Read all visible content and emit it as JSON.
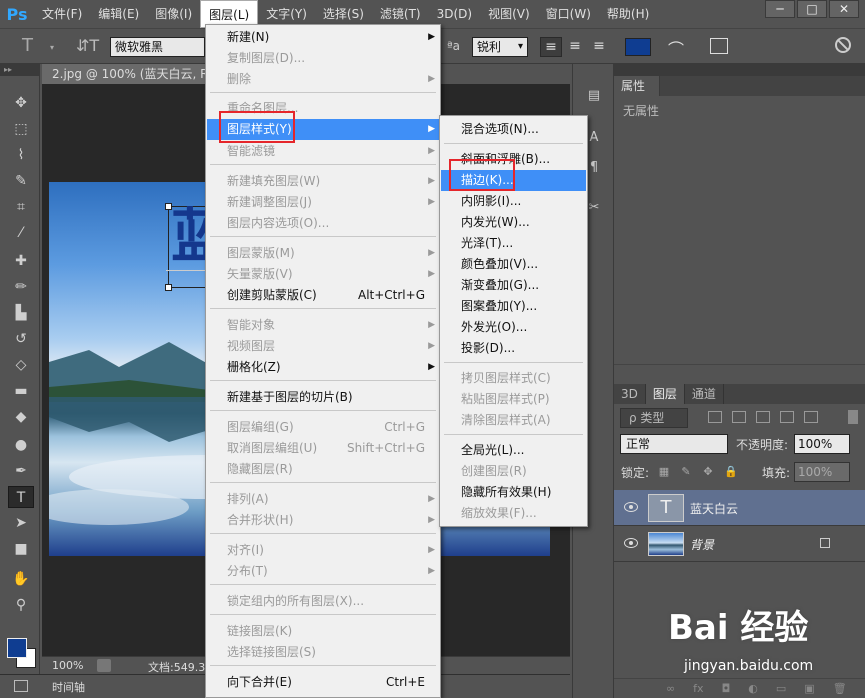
{
  "app": {
    "logo": "Ps"
  },
  "menubar": {
    "items": [
      "文件(F)",
      "编辑(E)",
      "图像(I)",
      "图层(L)",
      "文字(Y)",
      "选择(S)",
      "滤镜(T)",
      "3D(D)",
      "视图(V)",
      "窗口(W)",
      "帮助(H)"
    ],
    "active_index": 3
  },
  "window_buttons": [
    "─",
    "□",
    "✕"
  ],
  "options_bar": {
    "font_family": "微软雅黑",
    "aa_label": "ªa",
    "antialias": "锐利",
    "text_color": "#0f3d91"
  },
  "document": {
    "tab_title": "2.jpg @ 100% (蓝天白云, RG",
    "text_layer_char": "蓝",
    "zoom": "100%",
    "doc_info": "文档:549.3"
  },
  "timeline": {
    "label": "时间轴"
  },
  "properties_panel": {
    "tab": "属性",
    "empty_text": "无属性"
  },
  "layers_panel": {
    "tabs": [
      "3D",
      "图层",
      "通道"
    ],
    "active_tab": 1,
    "filter_label": "ρ 类型",
    "blend_mode": "正常",
    "opacity_label": "不透明度:",
    "opacity": "100%",
    "lock_label": "锁定:",
    "fill_label": "填充:",
    "fill": "100%",
    "layers": [
      {
        "name": "蓝天白云",
        "type": "text",
        "selected": true,
        "thumb": "T"
      },
      {
        "name": "背景",
        "type": "image",
        "selected": false,
        "locked": true
      }
    ],
    "footer_icons": [
      "∞",
      "fx",
      "◘",
      "◐",
      "▭",
      "▣",
      "🗑"
    ]
  },
  "layer_menu": {
    "items": [
      {
        "label": "新建(N)",
        "submenu": true,
        "disabled": false
      },
      {
        "label": "复制图层(D)...",
        "disabled": true
      },
      {
        "label": "删除",
        "submenu": true,
        "disabled": true
      },
      {
        "label": "重命名图层...",
        "disabled": true
      },
      {
        "label": "图层样式(Y)",
        "submenu": true,
        "highlight": true
      },
      {
        "label": "智能滤镜",
        "submenu": true,
        "disabled": true
      },
      {
        "label": "新建填充图层(W)",
        "submenu": true,
        "disabled": true
      },
      {
        "label": "新建调整图层(J)",
        "submenu": true,
        "disabled": true
      },
      {
        "label": "图层内容选项(O)...",
        "disabled": true
      },
      {
        "label": "图层蒙版(M)",
        "submenu": true,
        "disabled": true
      },
      {
        "label": "矢量蒙版(V)",
        "submenu": true,
        "disabled": true
      },
      {
        "label": "创建剪贴蒙版(C)",
        "shortcut": "Alt+Ctrl+G",
        "disabled": false
      },
      {
        "label": "智能对象",
        "submenu": true,
        "disabled": true
      },
      {
        "label": "视频图层",
        "submenu": true,
        "disabled": true
      },
      {
        "label": "栅格化(Z)",
        "submenu": true,
        "disabled": false
      },
      {
        "label": "新建基于图层的切片(B)",
        "disabled": false
      },
      {
        "label": "图层编组(G)",
        "shortcut": "Ctrl+G",
        "disabled": true
      },
      {
        "label": "取消图层编组(U)",
        "shortcut": "Shift+Ctrl+G",
        "disabled": true
      },
      {
        "label": "隐藏图层(R)",
        "disabled": true
      },
      {
        "label": "排列(A)",
        "submenu": true,
        "disabled": true
      },
      {
        "label": "合并形状(H)",
        "submenu": true,
        "disabled": true
      },
      {
        "label": "对齐(I)",
        "submenu": true,
        "disabled": true
      },
      {
        "label": "分布(T)",
        "submenu": true,
        "disabled": true
      },
      {
        "label": "锁定组内的所有图层(X)...",
        "disabled": true
      },
      {
        "label": "链接图层(K)",
        "disabled": true
      },
      {
        "label": "选择链接图层(S)",
        "disabled": true
      },
      {
        "label": "向下合并(E)",
        "shortcut": "Ctrl+E",
        "disabled": false
      }
    ]
  },
  "style_submenu": {
    "items": [
      {
        "label": "混合选项(N)...",
        "disabled": false
      },
      {
        "label": "斜面和浮雕(B)...",
        "disabled": false
      },
      {
        "label": "描边(K)...",
        "highlight": true
      },
      {
        "label": "内阴影(I)...",
        "disabled": false
      },
      {
        "label": "内发光(W)...",
        "disabled": false
      },
      {
        "label": "光泽(T)...",
        "disabled": false
      },
      {
        "label": "颜色叠加(V)...",
        "disabled": false
      },
      {
        "label": "渐变叠加(G)...",
        "disabled": false
      },
      {
        "label": "图案叠加(Y)...",
        "disabled": false
      },
      {
        "label": "外发光(O)...",
        "disabled": false
      },
      {
        "label": "投影(D)...",
        "disabled": false
      },
      {
        "label": "拷贝图层样式(C)",
        "disabled": true
      },
      {
        "label": "粘贴图层样式(P)",
        "disabled": true
      },
      {
        "label": "清除图层样式(A)",
        "disabled": true
      },
      {
        "label": "全局光(L)...",
        "disabled": false
      },
      {
        "label": "创建图层(R)",
        "disabled": true
      },
      {
        "label": "隐藏所有效果(H)",
        "disabled": false
      },
      {
        "label": "缩放效果(F)...",
        "disabled": true
      }
    ]
  },
  "watermark": {
    "logo": "Bai 经验",
    "url": "jingyan.baidu.com"
  }
}
